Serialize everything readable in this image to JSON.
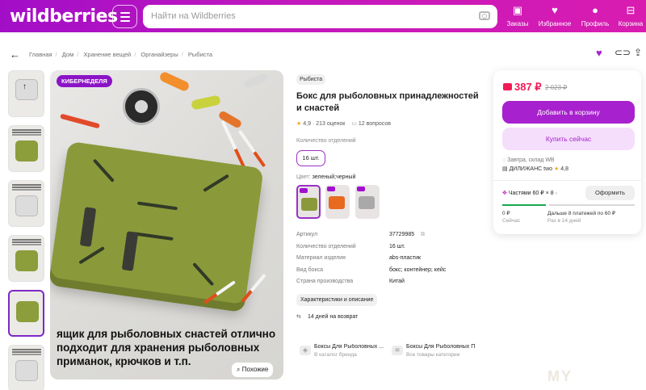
{
  "header": {
    "logo": "wildberries",
    "search_placeholder": "Найти на Wildberries",
    "nav": [
      {
        "label": "Заказы",
        "icon": "box-icon"
      },
      {
        "label": "Избранное",
        "icon": "heart-icon"
      },
      {
        "label": "Профиль",
        "icon": "user-icon"
      },
      {
        "label": "Корзина",
        "icon": "cart-icon"
      }
    ]
  },
  "breadcrumbs": [
    "Главная",
    "Дом",
    "Хранение вещей",
    "Органайзеры",
    "Рыбиста"
  ],
  "gallery": {
    "badge": "КИБЕРНЕДЕЛЯ",
    "caption": "ящик для рыболовных снастей отлично подходит для хранения рыболовных приманок, крючков и т.п.",
    "similar_label": "Похожие"
  },
  "product": {
    "brand_tag": "Рыбиста",
    "title": "Бокс для рыболовных принадлежностей и снастей",
    "rating": "4,9",
    "reviews": "213 оценок",
    "questions": "12 вопросов",
    "compartments_label": "Количество отделений",
    "compartments_value": "16 шт.",
    "color_label": "Цвет:",
    "color_value": "зеленый;черный",
    "specs": [
      {
        "k": "Артикул",
        "v": "37729985"
      },
      {
        "k": "Количество отделений",
        "v": "16 шт."
      },
      {
        "k": "Материал изделия",
        "v": "abs-пластик"
      },
      {
        "k": "Вид бокса",
        "v": "бокс; контейнер; кейс"
      },
      {
        "k": "Страна производства",
        "v": "Китай"
      }
    ],
    "chars_button": "Характеристики и описание",
    "return_text": "14 дней на возврат"
  },
  "related": [
    {
      "title": "Боксы Для Рыболовных ...",
      "sub": "В каталог бренда"
    },
    {
      "title": "Боксы Для Рыболовных П...",
      "sub": "Все товары категории"
    }
  ],
  "buy": {
    "price": "387 ₽",
    "old_price": "2 023 ₽",
    "add_to_cart": "Добавить в корзину",
    "buy_now": "Купить сейчас",
    "delivery": "Завтра, склад WB",
    "seller": "ДИЛИЖАНС two",
    "seller_rating": "4,8",
    "installment": "Частями 60 ₽ × 8",
    "installment_button": "Оформить",
    "pay_now": "0 ₽",
    "pay_now_sub": "Сейчас",
    "pay_later": "Дальше 8 платежей по 60 ₽",
    "pay_later_sub": "Раз в 14 дней"
  },
  "watermark": "MY",
  "colors": {
    "accent": "#a821ce",
    "price": "#f01a55"
  }
}
